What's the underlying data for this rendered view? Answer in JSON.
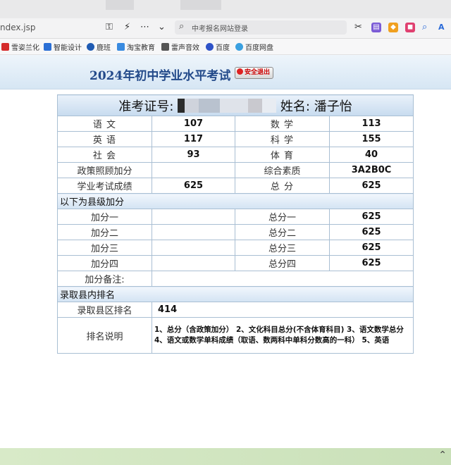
{
  "browser": {
    "url": "ndex.jsp",
    "search_placeholder": "中考报名网站登录",
    "bookmarks": [
      "雪姿兰化",
      "智能设计",
      "鹿班",
      "淘宝教育",
      "雷声音效",
      "百度",
      "百度网盘"
    ],
    "icons": [
      "key-icon",
      "bolt-icon",
      "more-icon",
      "chevron-down-icon",
      "scissors-icon",
      "note-icon",
      "shield-icon",
      "cart-icon",
      "search-icon",
      "font-icon"
    ]
  },
  "page": {
    "title": "2024年初中学业水平考试",
    "logout_label": "安全退出"
  },
  "exam": {
    "ticket_label": "准考证号:",
    "name_label": "姓名:",
    "name_value": "潘子怡",
    "subjects": [
      {
        "l_label": "语 文",
        "l_value": "107",
        "r_label": "数 学",
        "r_value": "113"
      },
      {
        "l_label": "英 语",
        "l_value": "117",
        "r_label": "科 学",
        "r_value": "155"
      },
      {
        "l_label": "社 会",
        "l_value": "93",
        "r_label": "体 育",
        "r_value": "40"
      },
      {
        "l_label": "政策照顾加分",
        "l_value": "",
        "r_label": "综合素质",
        "r_value": "3A2B0C"
      },
      {
        "l_label": "学业考试成绩",
        "l_value": "625",
        "r_label": "总 分",
        "r_value": "625"
      }
    ],
    "county_section": "以下为县级加分",
    "bonus_rows": [
      {
        "l_label": "加分一",
        "l_value": "",
        "r_label": "总分一",
        "r_value": "625"
      },
      {
        "l_label": "加分二",
        "l_value": "",
        "r_label": "总分二",
        "r_value": "625"
      },
      {
        "l_label": "加分三",
        "l_value": "",
        "r_label": "总分三",
        "r_value": "625"
      },
      {
        "l_label": "加分四",
        "l_value": "",
        "r_label": "总分四",
        "r_value": "625"
      }
    ],
    "bonus_note_label": "加分备注:",
    "rank_section": "录取县内排名",
    "rank_label": "录取县区排名",
    "rank_value": "414",
    "rank_note_label": "排名说明",
    "rank_note": "1、总分（含政策加分） 2、文化科目总分(不含体育科目) 3、语文数学总分 4、语文或数学单科成绩（取语、数两科中单科分数高的一科） 5、英语"
  },
  "colors": {
    "title": "#234a8a",
    "border": "#a9bfd3",
    "header_bg": "#c7dbef"
  }
}
